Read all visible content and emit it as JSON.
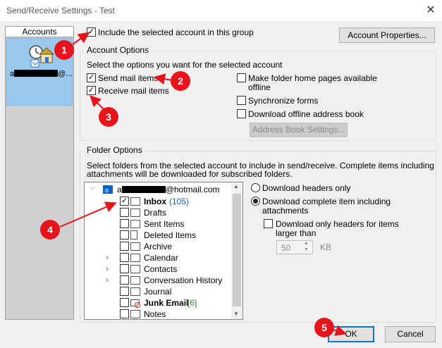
{
  "window": {
    "title": "Send/Receive Settings - Test",
    "close_glyph": "✕"
  },
  "accounts_panel": {
    "header": "Accounts",
    "account_prefix": "a",
    "account_suffix": "@..."
  },
  "top": {
    "include_label": "Include the selected account in this group",
    "account_properties_label": "Account Properties..."
  },
  "account_options": {
    "legend": "Account Options",
    "description": "Select the options you want for the selected account",
    "send_mail": "Send mail items",
    "receive_mail": "Receive mail items",
    "make_home_pages_1": "Make folder home pages available",
    "make_home_pages_2": "offline",
    "sync_forms": "Synchronize forms",
    "download_oab": "Download offline address book",
    "address_book_settings": "Address Book Settings..."
  },
  "folder_options": {
    "legend": "Folder Options",
    "desc_line1": "Select folders from the selected account to include in send/receive. Complete items including",
    "desc_line2": "attachments will be downloaded for subscribed folders.",
    "root_prefix": "a",
    "root_suffix": "@hotmail.com",
    "folders": [
      {
        "name": "Inbox",
        "badge": "(105)",
        "checked": true,
        "bold": true
      },
      {
        "name": "Drafts",
        "badge": "",
        "checked": false
      },
      {
        "name": "Sent Items",
        "badge": "",
        "checked": false
      },
      {
        "name": "Deleted Items",
        "badge": "",
        "checked": false
      },
      {
        "name": "Archive",
        "badge": "",
        "checked": false
      },
      {
        "name": "Calendar",
        "badge": "",
        "checked": false
      },
      {
        "name": "Contacts",
        "badge": "",
        "checked": false
      },
      {
        "name": "Conversation History",
        "badge": "",
        "checked": false
      },
      {
        "name": "Journal",
        "badge": "",
        "checked": false
      },
      {
        "name": "Junk Email",
        "badge": "[6]",
        "checked": false,
        "bold": true
      },
      {
        "name": "Notes",
        "badge": "",
        "checked": false
      }
    ],
    "download_headers_only": "Download headers only",
    "download_complete_1": "Download complete item including",
    "download_complete_2": "attachments",
    "download_only_headers_1": "Download only headers for items",
    "download_only_headers_2": "larger than",
    "size_value": "50",
    "size_unit": "KB"
  },
  "buttons": {
    "ok": "OK",
    "cancel": "Cancel"
  },
  "markers": [
    "1",
    "2",
    "3",
    "4",
    "5"
  ],
  "colors": {
    "marker": "#e8141c",
    "selection": "#99c9ef",
    "default_button_border": "#0078d7"
  }
}
